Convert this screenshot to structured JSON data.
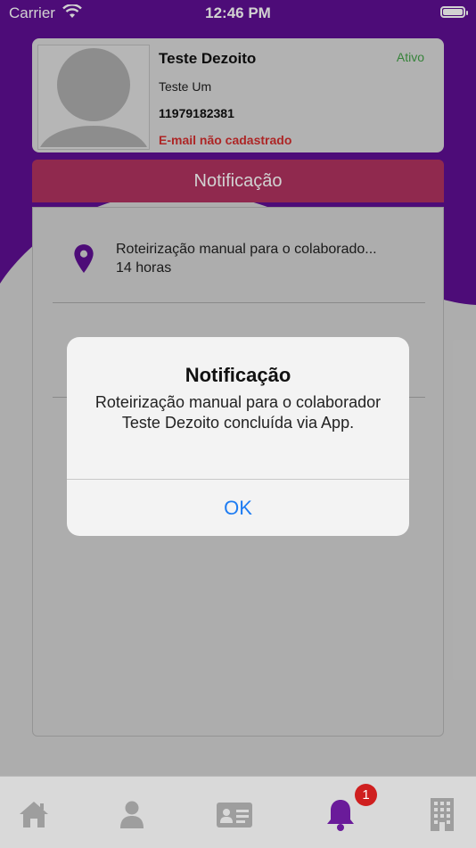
{
  "status_bar": {
    "carrier": "Carrier",
    "time": "12:46 PM"
  },
  "profile": {
    "name": "Teste Dezoito",
    "status": "Ativo",
    "company": "Teste Um",
    "phone": "11979182381",
    "email": "E-mail não cadastrado"
  },
  "header": {
    "title": "Notificação"
  },
  "notifications": [
    {
      "title": "Roteirização manual para o colaborado...",
      "time": "14 horas",
      "icon": "location-pin-icon"
    }
  ],
  "alert": {
    "title": "Notificação",
    "message": "Roteirização manual para o colaborador Teste Dezoito concluída via App.",
    "ok_label": "OK"
  },
  "tabbar": {
    "tabs": [
      {
        "name": "home",
        "icon": "home-icon"
      },
      {
        "name": "profile",
        "icon": "person-icon"
      },
      {
        "name": "id-card",
        "icon": "id-card-icon"
      },
      {
        "name": "notifications",
        "icon": "bell-icon",
        "active": true
      },
      {
        "name": "company",
        "icon": "building-icon"
      }
    ],
    "notifications_badge": "1"
  },
  "colors": {
    "purple": "#5e0f93",
    "header": "#b03360",
    "active_tab": "#6a1b9a",
    "inactive_tab": "#9e9e9e",
    "status_active": "#43a047",
    "email_warning": "#d32f2f",
    "link_blue": "#1e7cf2"
  }
}
